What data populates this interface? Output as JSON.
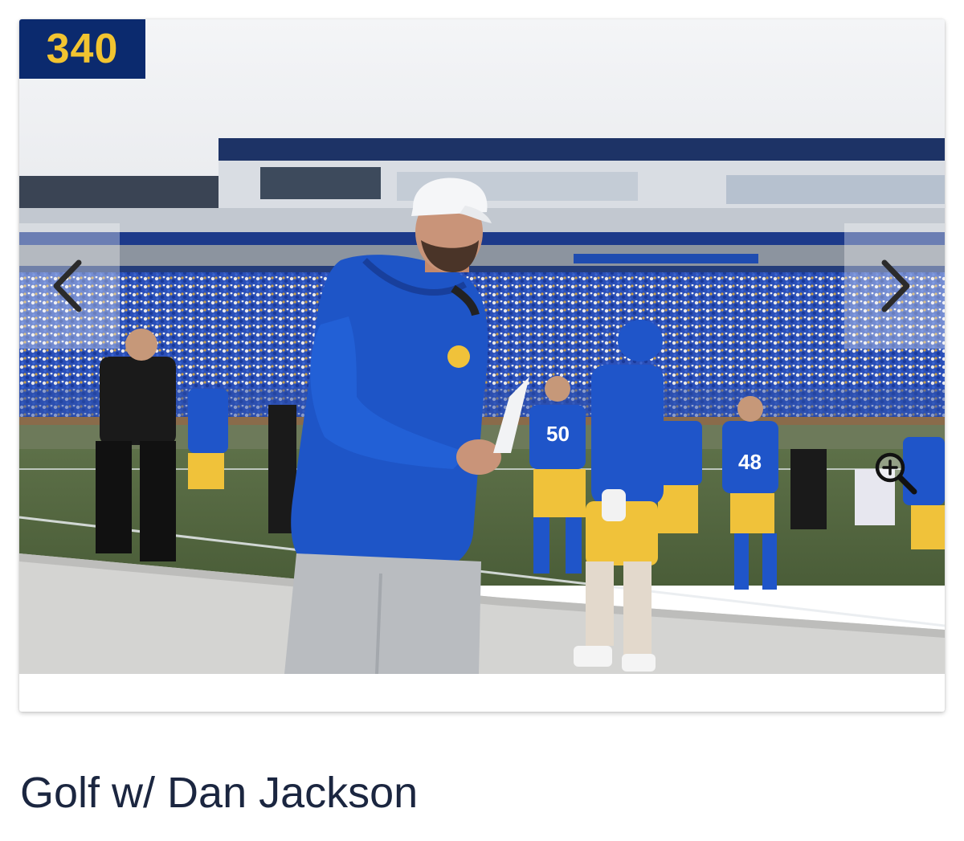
{
  "card": {
    "badge_number": "340",
    "photo_alt": "Coach in blue hoodie and white cap walking on sideline in football stadium with players and crowd",
    "prev_icon": "chevron-left-icon",
    "next_icon": "chevron-right-icon",
    "zoom_icon": "zoom-in-icon"
  },
  "caption": {
    "title": "Golf w/ Dan Jackson"
  },
  "colors": {
    "badge_bg": "#0b2a6e",
    "badge_text": "#f2c430",
    "caption_text": "#1b2640",
    "jersey_blue": "#1f55c9",
    "pants_yellow": "#f0c23a"
  }
}
